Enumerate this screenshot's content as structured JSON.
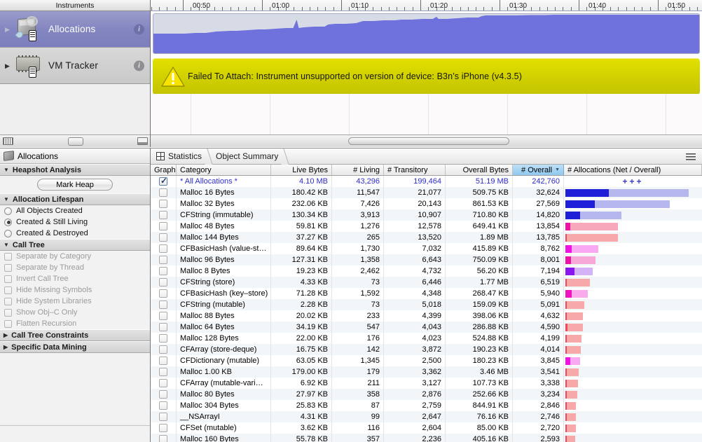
{
  "instruments_panel": {
    "header": "Instruments",
    "rows": [
      {
        "label": "Allocations",
        "icon": "allocations-cube-icon",
        "selected": true,
        "info": "i"
      },
      {
        "label": "VM Tracker",
        "icon": "vm-tracker-chip-icon",
        "selected": false,
        "info": "i"
      }
    ]
  },
  "timeline": {
    "ruler_labels": [
      "00:50",
      "01:00",
      "01:10",
      "01:20",
      "01:30",
      "01:40",
      "01:50"
    ],
    "ruler_label_x": [
      272,
      385,
      498,
      611,
      724,
      837,
      950
    ],
    "warning": {
      "icon": "warning-triangle-icon",
      "text": "Failed To Attach: Instrument unsupported on version of device: B3n’s iPhone (v4.3.5)",
      "background_color": "#d8d700"
    },
    "graph_fill_color": "#6f71dc",
    "graph_bg_color": "#d7dbe6"
  },
  "options_panel": {
    "title": "Allocations",
    "groups": [
      {
        "name": "Heapshot Analysis",
        "expanded": true
      },
      {
        "name": "Allocation Lifespan",
        "expanded": true
      },
      {
        "name": "Call Tree",
        "expanded": true
      },
      {
        "name": "Call Tree Constraints",
        "expanded": false
      },
      {
        "name": "Specific Data Mining",
        "expanded": false
      }
    ],
    "mark_heap_button": "Mark Heap",
    "lifespan_options": [
      {
        "label": "All Objects Created",
        "selected": false
      },
      {
        "label": "Created & Still Living",
        "selected": true
      },
      {
        "label": "Created & Destroyed",
        "selected": false
      }
    ],
    "call_tree_options": [
      {
        "label": "Separate by Category",
        "checked": false,
        "disabled": true
      },
      {
        "label": "Separate by Thread",
        "checked": false,
        "disabled": true
      },
      {
        "label": "Invert Call Tree",
        "checked": false,
        "disabled": true
      },
      {
        "label": "Hide Missing Symbols",
        "checked": false,
        "disabled": true
      },
      {
        "label": "Hide System Libraries",
        "checked": false,
        "disabled": true
      },
      {
        "label": "Show Obj–C Only",
        "checked": false,
        "disabled": true
      },
      {
        "label": "Flatten Recursion",
        "checked": false,
        "disabled": true
      }
    ]
  },
  "detail_panel": {
    "breadcrumbs": [
      "Statistics",
      "Object Summary"
    ],
    "menu_icon": "hamburger-menu-icon",
    "columns": [
      "Graph",
      "Category",
      "Live Bytes",
      "# Living",
      "# Transitory",
      "Overall Bytes",
      "# Overall",
      "# Allocations (Net / Overall)"
    ],
    "sorted_column": "# Overall",
    "sort_direction": "descending",
    "plus_marks": "+++",
    "rows": [
      {
        "checked": true,
        "category": "* All Allocations *",
        "live_bytes": "4.10 MB",
        "living": "43,296",
        "transitory": "199,464",
        "overall_bytes": "51.19 MB",
        "overall": "242,760",
        "net_pct": 0,
        "overall_pct": 0,
        "color_net": "#1f1fd8",
        "color_overall": "#b6b7ef"
      },
      {
        "checked": false,
        "category": "Malloc 16 Bytes",
        "live_bytes": "180.42 KB",
        "living": "11,547",
        "transitory": "21,077",
        "overall_bytes": "509.75 KB",
        "overall": "32,624",
        "net_pct": 35.5,
        "overall_pct": 100,
        "color_net": "#1f1fd8",
        "color_overall": "#b6b7ef"
      },
      {
        "checked": false,
        "category": "Malloc 32 Bytes",
        "live_bytes": "232.06 KB",
        "living": "7,426",
        "transitory": "20,143",
        "overall_bytes": "861.53 KB",
        "overall": "27,569",
        "net_pct": 24.0,
        "overall_pct": 84.5,
        "color_net": "#1f1fd8",
        "color_overall": "#b6b7ef"
      },
      {
        "checked": false,
        "category": "CFString (immutable)",
        "live_bytes": "130.34 KB",
        "living": "3,913",
        "transitory": "10,907",
        "overall_bytes": "710.80 KB",
        "overall": "14,820",
        "net_pct": 12.2,
        "overall_pct": 45.6,
        "color_net": "#1f1fd8",
        "color_overall": "#b6b7ef"
      },
      {
        "checked": false,
        "category": "Malloc 48 Bytes",
        "live_bytes": "59.81 KB",
        "living": "1,276",
        "transitory": "12,578",
        "overall_bytes": "649.41 KB",
        "overall": "13,854",
        "net_pct": 4.2,
        "overall_pct": 42.6,
        "color_net": "#ec13a4",
        "color_overall": "#f7a8bb"
      },
      {
        "checked": false,
        "category": "Malloc 144 Bytes",
        "live_bytes": "37.27 KB",
        "living": "265",
        "transitory": "13,520",
        "overall_bytes": "1.89 MB",
        "overall": "13,785",
        "net_pct": 1.0,
        "overall_pct": 42.4,
        "color_net": "#f2485c",
        "color_overall": "#f7a8a8"
      },
      {
        "checked": false,
        "category": "CFBasicHash (value-st…",
        "live_bytes": "89.64 KB",
        "living": "1,730",
        "transitory": "7,032",
        "overall_bytes": "415.89 KB",
        "overall": "8,762",
        "net_pct": 5.2,
        "overall_pct": 26.9,
        "color_net": "#ee13e0",
        "color_overall": "#f9a9f4"
      },
      {
        "checked": false,
        "category": "Malloc 96 Bytes",
        "live_bytes": "127.31 KB",
        "living": "1,358",
        "transitory": "6,643",
        "overall_bytes": "750.09 KB",
        "overall": "8,001",
        "net_pct": 4.5,
        "overall_pct": 24.5,
        "color_net": "#ec13a4",
        "color_overall": "#f7a8d8"
      },
      {
        "checked": false,
        "category": "Malloc 8 Bytes",
        "live_bytes": "19.23 KB",
        "living": "2,462",
        "transitory": "4,732",
        "overall_bytes": "56.20 KB",
        "overall": "7,194",
        "net_pct": 7.6,
        "overall_pct": 22.0,
        "color_net": "#8b15ee",
        "color_overall": "#d3b2f7"
      },
      {
        "checked": false,
        "category": "CFString (store)",
        "live_bytes": "4.33 KB",
        "living": "73",
        "transitory": "6,446",
        "overall_bytes": "1.77 MB",
        "overall": "6,519",
        "net_pct": 0.2,
        "overall_pct": 19.9,
        "color_net": "#f2485c",
        "color_overall": "#f7a8a8"
      },
      {
        "checked": false,
        "category": "CFBasicHash (key–store)",
        "live_bytes": "71.28 KB",
        "living": "1,592",
        "transitory": "4,348",
        "overall_bytes": "268.47 KB",
        "overall": "5,940",
        "net_pct": 4.9,
        "overall_pct": 18.2,
        "color_net": "#ee13be",
        "color_overall": "#f9a9ec"
      },
      {
        "checked": false,
        "category": "CFString (mutable)",
        "live_bytes": "2.28 KB",
        "living": "73",
        "transitory": "5,018",
        "overall_bytes": "159.09 KB",
        "overall": "5,091",
        "net_pct": 0.2,
        "overall_pct": 15.6,
        "color_net": "#f2485c",
        "color_overall": "#f7a8a8"
      },
      {
        "checked": false,
        "category": "Malloc 88 Bytes",
        "live_bytes": "20.02 KB",
        "living": "233",
        "transitory": "4,399",
        "overall_bytes": "398.06 KB",
        "overall": "4,632",
        "net_pct": 0.7,
        "overall_pct": 14.2,
        "color_net": "#f2485c",
        "color_overall": "#f7a8a8"
      },
      {
        "checked": false,
        "category": "Malloc 64 Bytes",
        "live_bytes": "34.19 KB",
        "living": "547",
        "transitory": "4,043",
        "overall_bytes": "286.88 KB",
        "overall": "4,590",
        "net_pct": 1.7,
        "overall_pct": 14.1,
        "color_net": "#f2485c",
        "color_overall": "#f7a8a8"
      },
      {
        "checked": false,
        "category": "Malloc 128 Bytes",
        "live_bytes": "22.00 KB",
        "living": "176",
        "transitory": "4,023",
        "overall_bytes": "524.88 KB",
        "overall": "4,199",
        "net_pct": 0.5,
        "overall_pct": 12.9,
        "color_net": "#f2485c",
        "color_overall": "#f7a8a8"
      },
      {
        "checked": false,
        "category": "CFArray (store-deque)",
        "live_bytes": "16.75 KB",
        "living": "142",
        "transitory": "3,872",
        "overall_bytes": "190.23 KB",
        "overall": "4,014",
        "net_pct": 0.4,
        "overall_pct": 12.3,
        "color_net": "#f2485c",
        "color_overall": "#f7a8a8"
      },
      {
        "checked": false,
        "category": "CFDictionary (mutable)",
        "live_bytes": "63.05 KB",
        "living": "1,345",
        "transitory": "2,500",
        "overall_bytes": "180.23 KB",
        "overall": "3,845",
        "net_pct": 4.1,
        "overall_pct": 11.8,
        "color_net": "#ee13e0",
        "color_overall": "#f9a9f4"
      },
      {
        "checked": false,
        "category": "Malloc 1.00 KB",
        "live_bytes": "179.00 KB",
        "living": "179",
        "transitory": "3,362",
        "overall_bytes": "3.46 MB",
        "overall": "3,541",
        "net_pct": 0.5,
        "overall_pct": 10.9,
        "color_net": "#f2485c",
        "color_overall": "#f7a8a8"
      },
      {
        "checked": false,
        "category": "CFArray (mutable-vari…",
        "live_bytes": "6.92 KB",
        "living": "211",
        "transitory": "3,127",
        "overall_bytes": "107.73 KB",
        "overall": "3,338",
        "net_pct": 0.6,
        "overall_pct": 10.2,
        "color_net": "#f2485c",
        "color_overall": "#f7a8a8"
      },
      {
        "checked": false,
        "category": "Malloc 80 Bytes",
        "live_bytes": "27.97 KB",
        "living": "358",
        "transitory": "2,876",
        "overall_bytes": "252.66 KB",
        "overall": "3,234",
        "net_pct": 1.1,
        "overall_pct": 9.9,
        "color_net": "#f2485c",
        "color_overall": "#f7a8a8"
      },
      {
        "checked": false,
        "category": "Malloc 304 Bytes",
        "live_bytes": "25.83 KB",
        "living": "87",
        "transitory": "2,759",
        "overall_bytes": "844.91 KB",
        "overall": "2,846",
        "net_pct": 0.3,
        "overall_pct": 8.7,
        "color_net": "#f2485c",
        "color_overall": "#f7a8a8"
      },
      {
        "checked": false,
        "category": "__NSArrayI",
        "live_bytes": "4.31 KB",
        "living": "99",
        "transitory": "2,647",
        "overall_bytes": "76.16 KB",
        "overall": "2,746",
        "net_pct": 0.3,
        "overall_pct": 8.4,
        "color_net": "#f2485c",
        "color_overall": "#f7a8a8"
      },
      {
        "checked": false,
        "category": "CFSet (mutable)",
        "live_bytes": "3.62 KB",
        "living": "116",
        "transitory": "2,604",
        "overall_bytes": "85.00 KB",
        "overall": "2,720",
        "net_pct": 0.4,
        "overall_pct": 8.3,
        "color_net": "#f2485c",
        "color_overall": "#f7a8a8"
      },
      {
        "checked": false,
        "category": "Malloc 160 Bytes",
        "live_bytes": "55.78 KB",
        "living": "357",
        "transitory": "2,236",
        "overall_bytes": "405.16 KB",
        "overall": "2,593",
        "net_pct": 1.1,
        "overall_pct": 7.9,
        "color_net": "#f2485c",
        "color_overall": "#f7a8a8"
      }
    ]
  }
}
